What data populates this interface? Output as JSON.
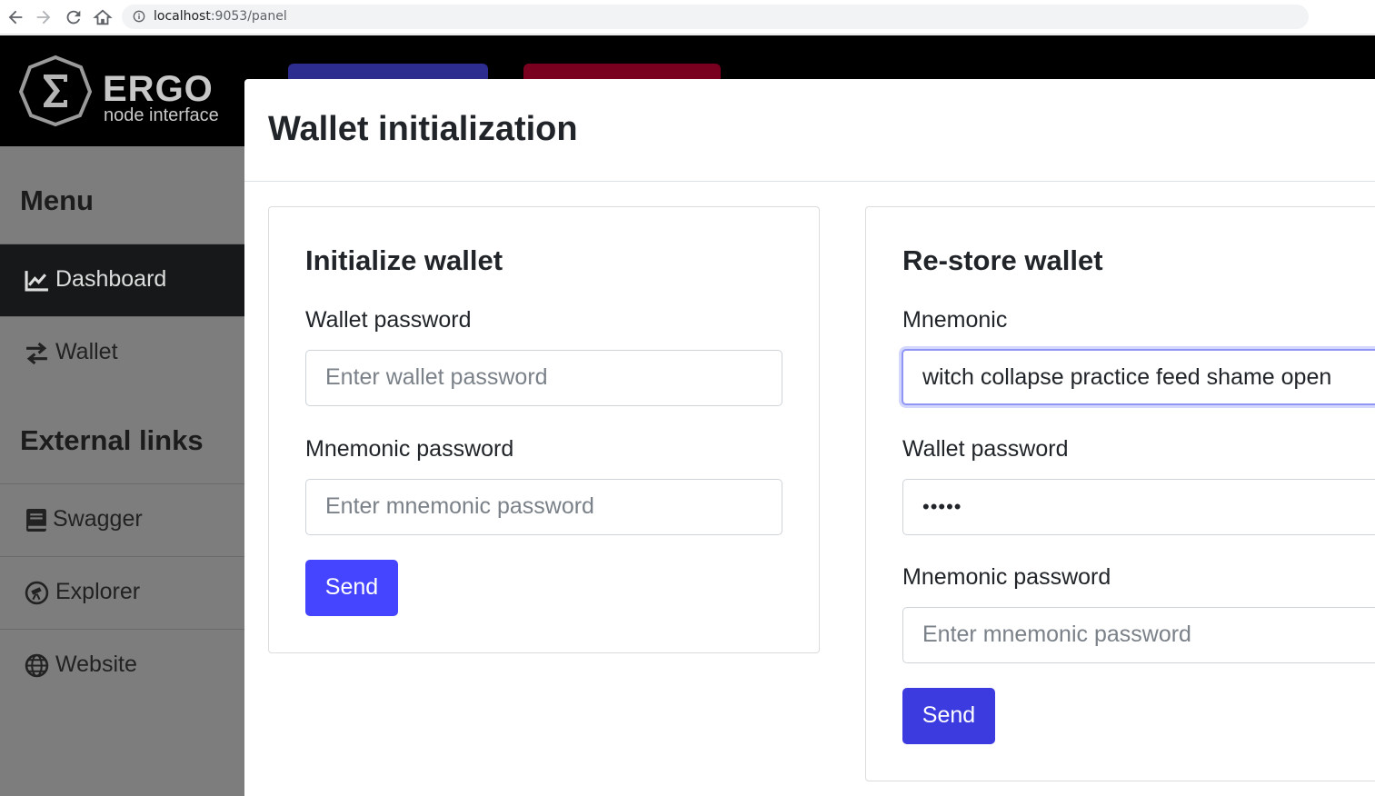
{
  "browser": {
    "url_host": "localhost",
    "url_rest": ":9053/panel"
  },
  "brand": {
    "title": "ERGO",
    "subtitle": "node interface"
  },
  "sidebar": {
    "menu_heading": "Menu",
    "menu_items": [
      {
        "label": "Dashboard",
        "icon": "chart-line-icon"
      },
      {
        "label": "Wallet",
        "icon": "exchange-arrows-icon"
      }
    ],
    "external_heading": "External links",
    "external_items": [
      {
        "label": "Swagger",
        "icon": "book-icon"
      },
      {
        "label": "Explorer",
        "icon": "telescope-icon"
      },
      {
        "label": "Website",
        "icon": "globe-icon"
      }
    ]
  },
  "modal": {
    "title": "Wallet initialization",
    "init_card": {
      "title": "Initialize wallet",
      "wallet_password_label": "Wallet password",
      "wallet_password_placeholder": "Enter wallet password",
      "mnemonic_password_label": "Mnemonic password",
      "mnemonic_password_placeholder": "Enter mnemonic password",
      "send_label": "Send"
    },
    "restore_card": {
      "title": "Re-store wallet",
      "mnemonic_label": "Mnemonic",
      "mnemonic_value": "witch collapse practice feed shame open",
      "wallet_password_label": "Wallet password",
      "wallet_password_value": "•••••",
      "mnemonic_password_label": "Mnemonic password",
      "mnemonic_password_placeholder": "Enter mnemonic password",
      "send_label": "Send"
    }
  }
}
